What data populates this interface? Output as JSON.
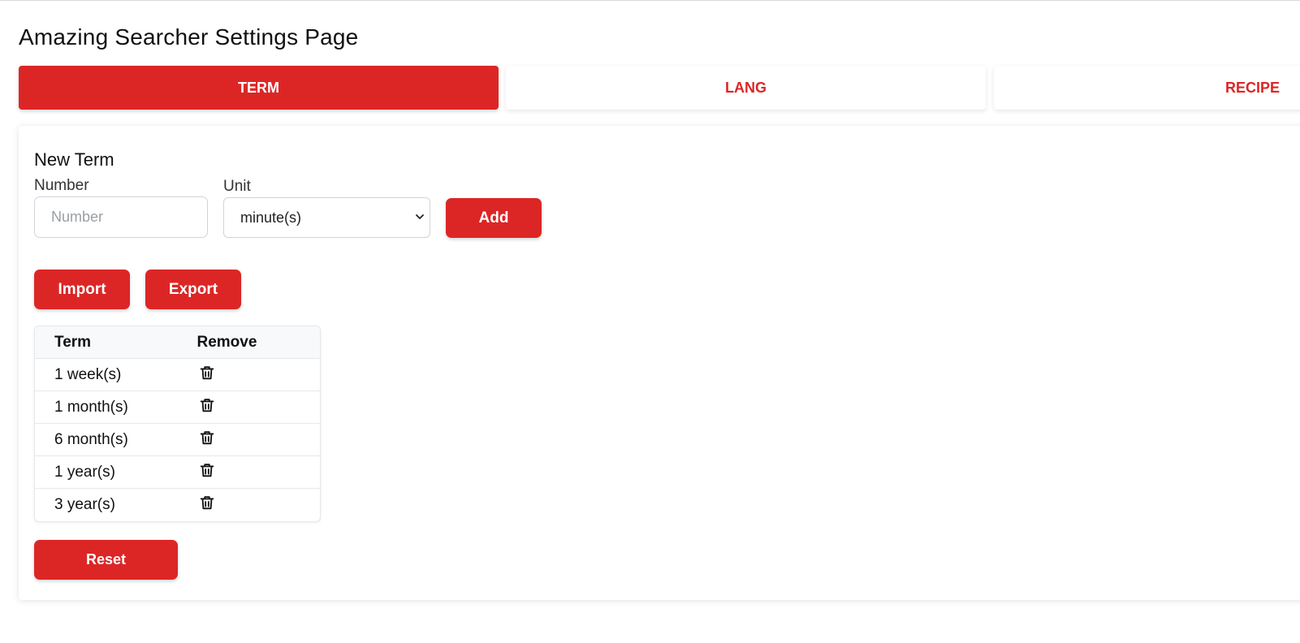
{
  "page": {
    "title": "Amazing Searcher Settings Page"
  },
  "tabs": [
    {
      "label": "TERM",
      "active": true
    },
    {
      "label": "LANG",
      "active": false
    },
    {
      "label": "RECIPE",
      "active": false
    }
  ],
  "new_term": {
    "title": "New Term",
    "number_label": "Number",
    "number_placeholder": "Number",
    "unit_label": "Unit",
    "unit_selected": "minute(s)",
    "add_label": "Add"
  },
  "actions": {
    "import_label": "Import",
    "export_label": "Export",
    "reset_label": "Reset"
  },
  "table": {
    "headers": [
      "Term",
      "Remove"
    ],
    "rows": [
      {
        "term": "1 week(s)"
      },
      {
        "term": "1 month(s)"
      },
      {
        "term": "6 month(s)"
      },
      {
        "term": "1 year(s)"
      },
      {
        "term": "3 year(s)"
      }
    ],
    "remove_icon": "trash-icon"
  },
  "colors": {
    "accent": "#dc2626",
    "text": "#111111",
    "border": "#cfd4da"
  }
}
